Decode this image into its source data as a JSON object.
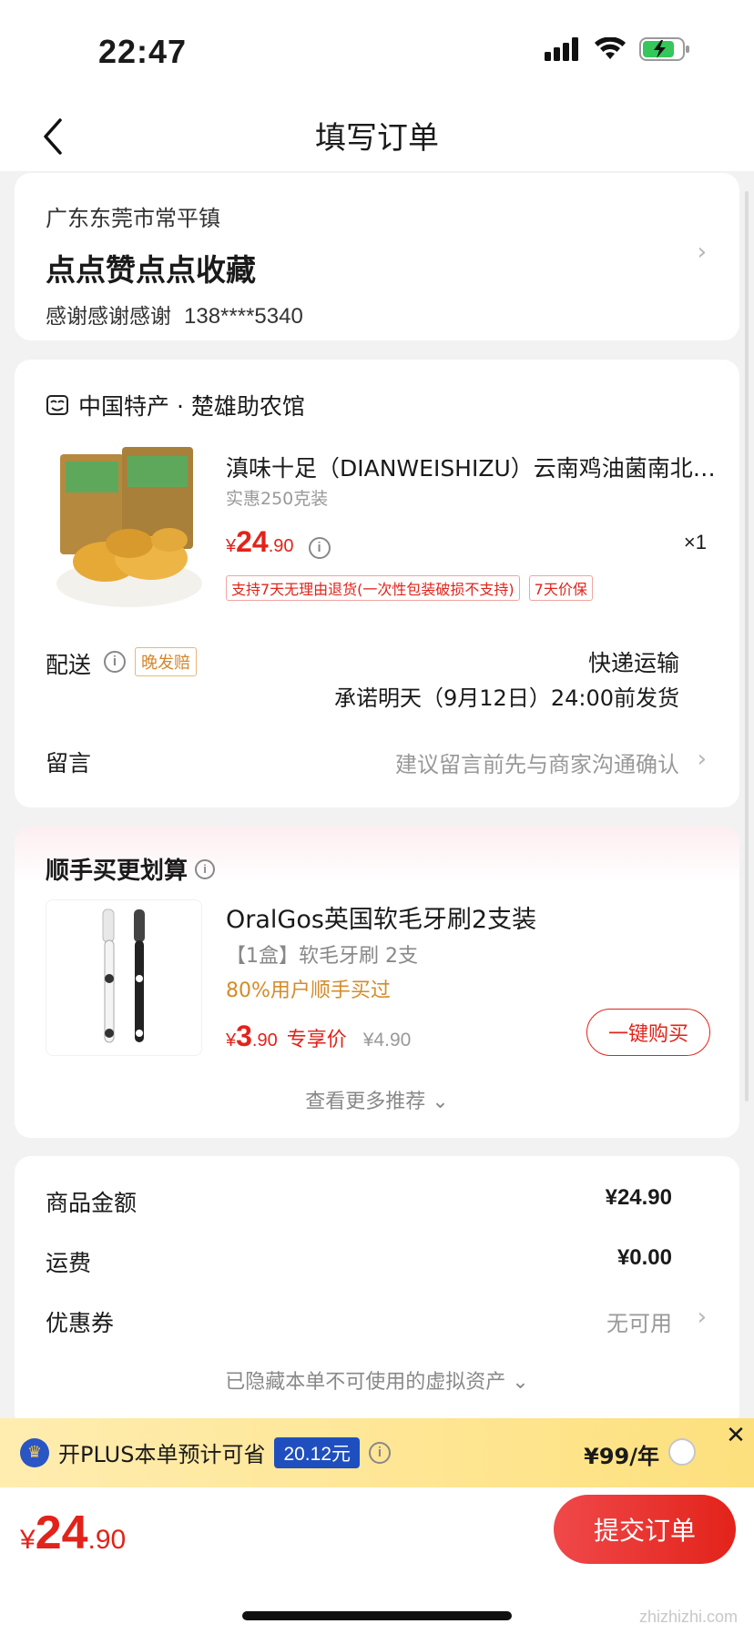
{
  "status_bar": {
    "time": "22:47"
  },
  "nav": {
    "title": "填写订单"
  },
  "address": {
    "region": "广东东莞市常平镇",
    "detail": "点点赞点点收藏",
    "name": "感谢感谢感谢",
    "phone": "138****5340"
  },
  "order": {
    "shop_name": "中国特产 · 楚雄助农馆",
    "product": {
      "title": "滇味十足（DIANWEISHIZU）云南鸡油菌南北干货",
      "spec": "实惠250克装",
      "price_yen": "¥",
      "price_int": "24",
      "price_dec": ".90",
      "quantity": "×1",
      "tags": [
        "支持7天无理由退货(一次性包装破损不支持)",
        "7天价保"
      ]
    },
    "shipping": {
      "label": "配送",
      "badge": "晚发赔",
      "method": "快递运输",
      "promise": "承诺明天（9月12日）24:00前发货"
    },
    "remark": {
      "label": "留言",
      "placeholder": "建议留言前先与商家沟通确认"
    }
  },
  "recommend": {
    "title": "顺手买更划算",
    "item": {
      "name": "OralGos英国软毛牙刷2支装",
      "spec": "【1盒】软毛牙刷 2支",
      "social": "80%用户顺手买过",
      "price_yen": "¥",
      "price_int": "3",
      "price_dec": ".90",
      "price_label": "专享价",
      "orig_price": "¥4.90",
      "buy_label": "一键购买"
    },
    "more_label": "查看更多推荐"
  },
  "summary": {
    "rows": [
      {
        "label": "商品金额",
        "value": "¥24.90"
      },
      {
        "label": "运费",
        "value": "¥0.00"
      },
      {
        "label": "优惠券",
        "value": "无可用"
      }
    ],
    "hidden_assets": "已隐藏本单不可使用的虚拟资产"
  },
  "plus": {
    "text": "开PLUS本单预计可省",
    "amount": "20.12元",
    "fee": "¥99/年"
  },
  "footer": {
    "total_yen": "¥",
    "total_int": "24",
    "total_dec": ".90",
    "submit_label": "提交订单",
    "watermark": "zhizhizhi.com"
  },
  "colors": {
    "accent": "#e2231a",
    "plus_bar": "#fde07d",
    "plus_badge": "#1f4fbf"
  },
  "icons": [
    "back-icon",
    "signal-icon",
    "wifi-icon",
    "battery-icon",
    "shop-icon",
    "info-icon",
    "chevron-right-icon",
    "chevron-down-icon",
    "crown-icon",
    "close-icon"
  ]
}
